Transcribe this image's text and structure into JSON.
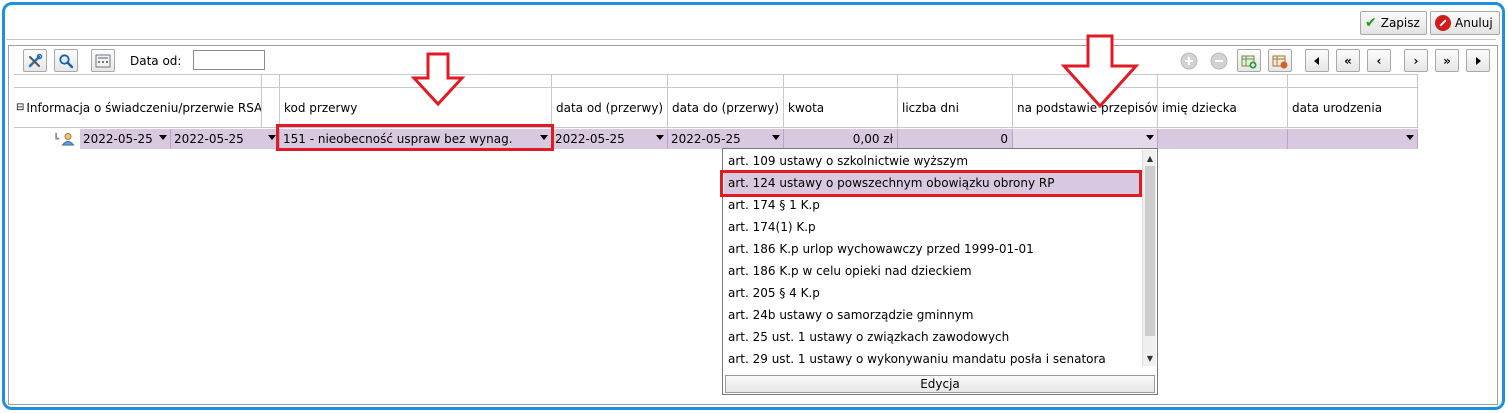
{
  "topbar": {
    "save_label": "Zapisz",
    "cancel_label": "Anuluj"
  },
  "toolbar": {
    "date_from_label": "Data od:",
    "date_from_value": "",
    "nav": {
      "first": "|◂",
      "prev_page": "«",
      "prev": "‹",
      "next": "›",
      "next_page": "»",
      "last": "▸|"
    }
  },
  "grid": {
    "columns": {
      "info": "Informacja o świadczeniu/przerwie RSA",
      "kod": "kod przerwy",
      "data_od": "data od (przerwy)",
      "data_do": "data do (przerwy)",
      "kwota": "kwota",
      "liczba_dni": "liczba dni",
      "podstawa": "na podstawie przepisów",
      "imie": "imię dziecka",
      "data_urodzenia": "data urodzenia"
    },
    "row": {
      "date1": "2022-05-25",
      "date2": "2022-05-25",
      "kod": "151 - nieobecność uspraw bez wynag.",
      "data_od": "2022-05-25",
      "data_do": "2022-05-25",
      "kwota": "0,00 zł",
      "liczba_dni": "0",
      "podstawa": "",
      "imie": "",
      "data_urodzenia": ""
    }
  },
  "dropdown": {
    "items": [
      "art. 109 ustawy o szkolnictwie wyższym",
      "art. 124 ustawy o powszechnym obowiązku obrony RP",
      "art. 174 § 1 K.p",
      "art. 174(1) K.p",
      "art. 186 K.p urlop wychowawczy przed 1999-01-01",
      "art. 186 K.p w celu opieki nad dzieckiem",
      "art. 205 § 4 K.p",
      "art. 24b ustawy o samorządzie gminnym",
      "art. 25 ust. 1 ustawy o związkach zawodowych",
      "art. 29 ust. 1 ustawy o wykonywaniu mandatu posła i senatora"
    ],
    "selected_index": 1,
    "footer_label": "Edycja"
  },
  "colors": {
    "accent_frame": "#1e90e0",
    "row_highlight": "#d9c9e0",
    "annotation_red": "#e01b24"
  }
}
